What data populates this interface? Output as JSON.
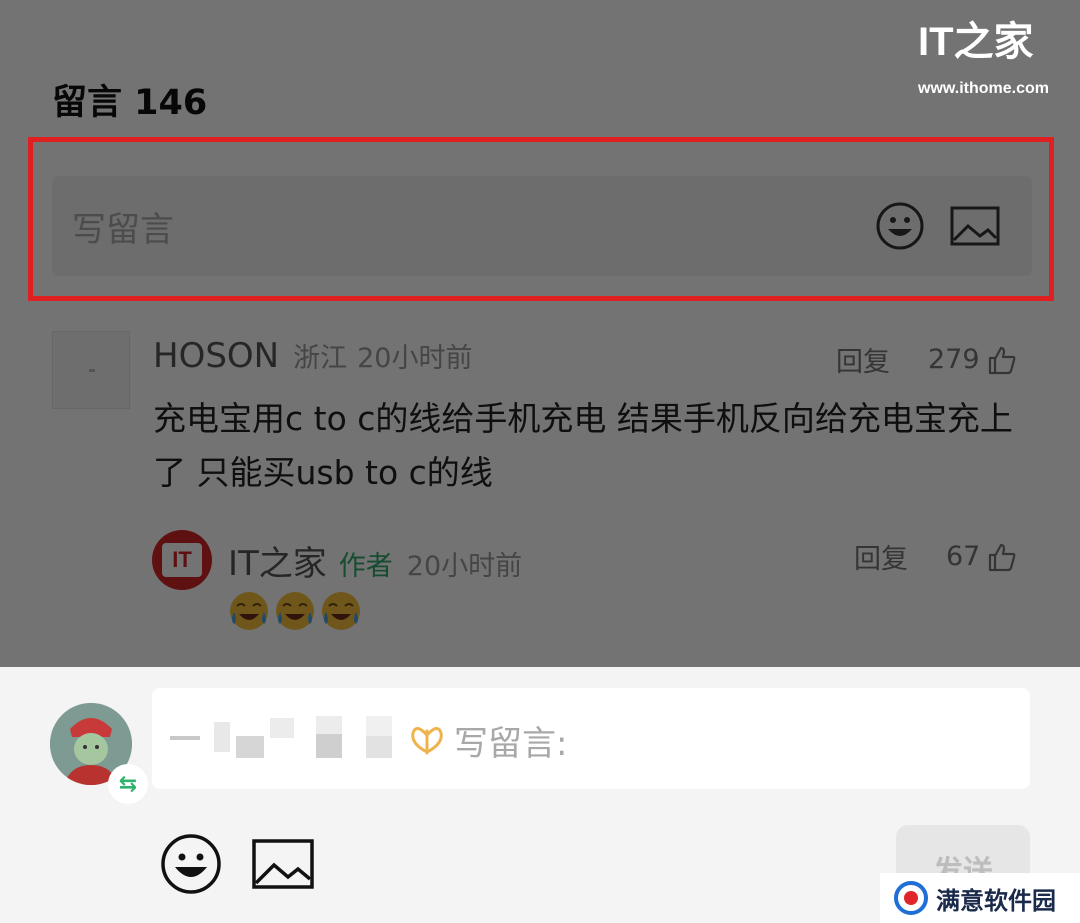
{
  "header": {
    "comments_label": "留言 146"
  },
  "brand": {
    "logo_text": "IT之家",
    "url": "www.ithome.com"
  },
  "comment_input": {
    "placeholder": "写留言"
  },
  "comment": {
    "username": "HOSON",
    "location": "浙江",
    "time": "20小时前",
    "reply_label": "回复",
    "likes": "279",
    "text": "充电宝用c to c的线给手机充电 结果手机反向给充电宝充上了 只能买usb to c的线"
  },
  "reply": {
    "username": "IT之家",
    "author_tag": "作者",
    "time": "20小时前",
    "reply_label": "回复",
    "likes": "67",
    "avatar_text": "IT",
    "emoji_count": 3
  },
  "composer": {
    "placeholder": "写留言:",
    "send_label": "发送",
    "switch_icon": "⇆"
  },
  "watermark": {
    "text": "满意软件园"
  },
  "colors": {
    "highlight_border": "#e02020",
    "author_tag": "#34a86b",
    "it_red": "#d32626",
    "send_disabled_bg": "#e6e6e6"
  }
}
